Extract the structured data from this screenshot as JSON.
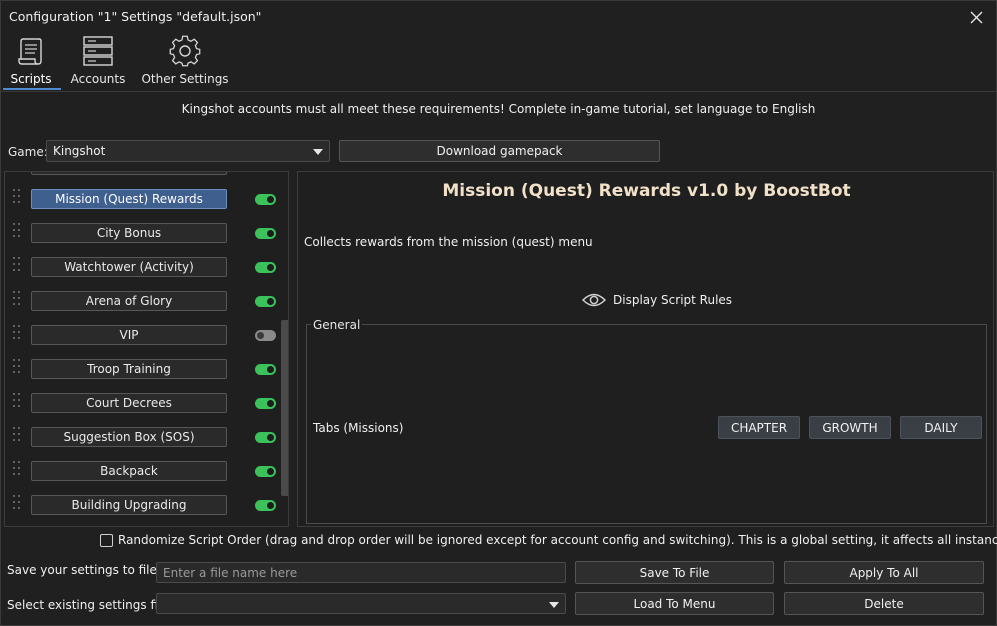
{
  "window": {
    "title": "Configuration \"1\" Settings \"default.json\"",
    "close_icon": "close-icon"
  },
  "tabs": [
    {
      "label": "Scripts",
      "icon": "scroll-icon",
      "active": true
    },
    {
      "label": "Accounts",
      "icon": "server-rack-icon",
      "active": false
    },
    {
      "label": "Other Settings",
      "icon": "gear-icon",
      "active": false
    }
  ],
  "notice": "Kingshot accounts must all meet these requirements! Complete in-game tutorial, set language to English",
  "game": {
    "label": "Game:",
    "selected": "Kingshot",
    "download_label": "Download gamepack"
  },
  "scripts": [
    {
      "name": "Mission (Quest) Rewards",
      "enabled": true,
      "selected": true
    },
    {
      "name": "City Bonus",
      "enabled": true,
      "selected": false
    },
    {
      "name": "Watchtower (Activity)",
      "enabled": true,
      "selected": false
    },
    {
      "name": "Arena of Glory",
      "enabled": true,
      "selected": false
    },
    {
      "name": "VIP",
      "enabled": false,
      "selected": false
    },
    {
      "name": "Troop Training",
      "enabled": true,
      "selected": false
    },
    {
      "name": "Court Decrees",
      "enabled": true,
      "selected": false
    },
    {
      "name": "Suggestion Box (SOS)",
      "enabled": true,
      "selected": false
    },
    {
      "name": "Backpack",
      "enabled": true,
      "selected": false
    },
    {
      "name": "Building Upgrading",
      "enabled": true,
      "selected": false
    }
  ],
  "details": {
    "title": "Mission (Quest) Rewards v1.0 by BoostBot",
    "description": "Collects rewards from the mission (quest) menu",
    "rules_label": "Display Script Rules",
    "general_legend": "General",
    "tabs_label": "Tabs (Missions)",
    "tab_buttons": [
      "CHAPTER",
      "GROWTH",
      "DAILY"
    ]
  },
  "randomize_label": "Randomize Script Order (drag and drop order will be ignored except for account config and switching). This is a global setting, it affects all instances.",
  "save_row": {
    "label": "Save your settings to file",
    "placeholder": "Enter a file name here",
    "save_button": "Save To File",
    "apply_button": "Apply To All"
  },
  "load_row": {
    "label": "Select existing settings file",
    "load_button": "Load To Menu",
    "delete_button": "Delete"
  },
  "colors": {
    "background": "#202020",
    "toggle_on": "#3cc25a",
    "toggle_off": "#8a8a8a",
    "selected_item": "#3f5f8f",
    "tab_underline": "#4e8bd0",
    "title_text": "#f0e1c8"
  }
}
